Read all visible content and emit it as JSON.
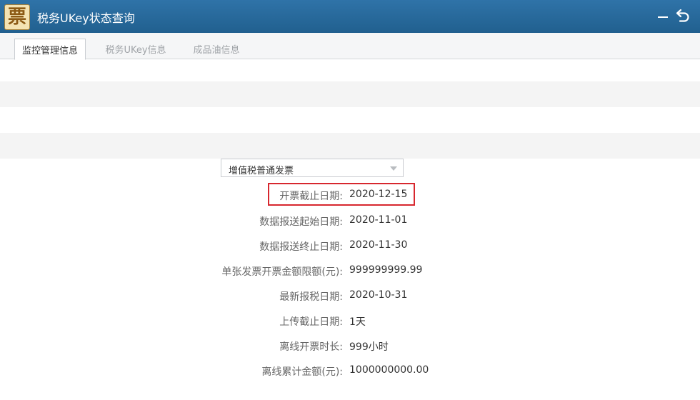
{
  "window": {
    "title": "税务UKey状态查询",
    "app_icon_glyph": "票",
    "accent_color": "#2a6a9b",
    "highlight_color": "#d7272e"
  },
  "tabs": [
    {
      "label": "监控管理信息",
      "active": true
    },
    {
      "label": "税务UKey信息",
      "active": false
    },
    {
      "label": "成品油信息",
      "active": false
    }
  ],
  "invoice_type_select": {
    "selected": "增值税普通发票"
  },
  "info": [
    {
      "label": "开票截止日期:",
      "value": "2020-12-15"
    },
    {
      "label": "数据报送起始日期:",
      "value": "2020-11-01"
    },
    {
      "label": "数据报送终止日期:",
      "value": "2020-11-30"
    },
    {
      "label": "单张发票开票金额限额(元):",
      "value": "999999999.99"
    },
    {
      "label": "最新报税日期:",
      "value": "2020-10-31"
    },
    {
      "label": "上传截止日期:",
      "value": "1天"
    },
    {
      "label": "离线开票时长:",
      "value": "999小时"
    },
    {
      "label": "离线累计金额(元):",
      "value": "1000000000.00"
    }
  ],
  "icons": {
    "minimize": "minimize-icon",
    "back": "back-arrow-icon",
    "dropdown": "chevron-down-icon"
  }
}
